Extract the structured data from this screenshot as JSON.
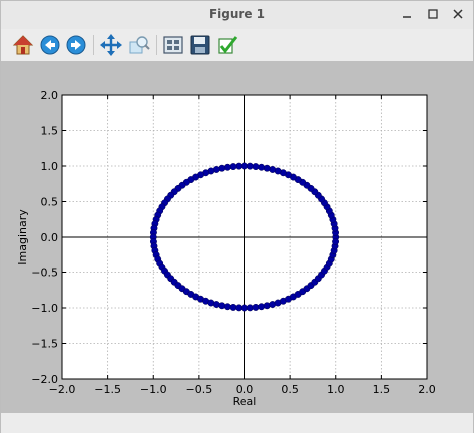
{
  "window": {
    "title": "Figure 1"
  },
  "toolbar": {
    "buttons": [
      {
        "name": "home-button",
        "icon": "home-icon"
      },
      {
        "name": "back-button",
        "icon": "back-arrow-icon"
      },
      {
        "name": "forward-button",
        "icon": "forward-arrow-icon"
      },
      {
        "name": "pan-button",
        "icon": "pan-move-icon"
      },
      {
        "name": "zoom-button",
        "icon": "zoom-rect-icon"
      },
      {
        "name": "configure-subplots-button",
        "icon": "subplots-icon"
      },
      {
        "name": "save-button",
        "icon": "floppy-disk-icon"
      },
      {
        "name": "edit-axis-button",
        "icon": "checkmark-icon"
      }
    ]
  },
  "chart_data": {
    "type": "scatter",
    "title": "",
    "xlabel": "Real",
    "ylabel": "Imaginary",
    "xlim": [
      -2.0,
      2.0
    ],
    "ylim": [
      -2.0,
      2.0
    ],
    "xticks": [
      -2.0,
      -1.5,
      -1.0,
      -0.5,
      0.0,
      0.5,
      1.0,
      1.5,
      2.0
    ],
    "yticks": [
      -2.0,
      -1.5,
      -1.0,
      -0.5,
      0.0,
      0.5,
      1.0,
      1.5,
      2.0
    ],
    "xtick_labels": [
      "−2.0",
      "−1.5",
      "−1.0",
      "−0.5",
      "0.0",
      "0.5",
      "1.0",
      "1.5",
      "2.0"
    ],
    "ytick_labels": [
      "−2.0",
      "−1.5",
      "−1.0",
      "−0.5",
      "0.0",
      "0.5",
      "1.0",
      "1.5",
      "2.0"
    ],
    "grid": true,
    "axes_lines": true,
    "marker_color": "#0000a0",
    "points_description": "unit circle sampled at 100 evenly spaced angles",
    "num_points": 100,
    "radius": 1.0
  },
  "colors": {
    "figure_bg": "#bfbfbf",
    "axes_bg": "#ffffff",
    "marker": "#0000a0"
  }
}
